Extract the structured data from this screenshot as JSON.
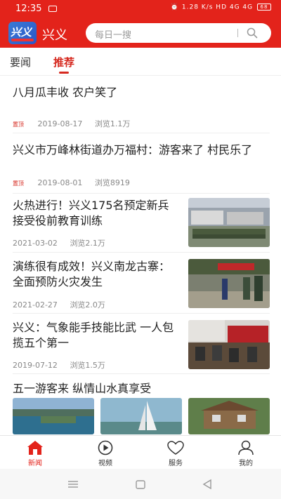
{
  "status_bar": {
    "time": "12:35",
    "network": "1.28 K/s",
    "signal": "HD 4G 4G",
    "battery": "68"
  },
  "header": {
    "logo_text": "兴义",
    "app_name": "兴义",
    "search_placeholder": "每日一搜"
  },
  "tabs": [
    {
      "label": "要闻"
    },
    {
      "label": "推荐"
    }
  ],
  "news": [
    {
      "title": "八月瓜丰收 农户笑了",
      "tag": "置顶",
      "date": "2019-08-17",
      "views": "浏览1.1万"
    },
    {
      "title": "兴义市万峰林街道办万福村：游客来了 村民乐了",
      "tag": "置顶",
      "date": "2019-08-01",
      "views": "浏览8919"
    },
    {
      "title": "火热进行！兴义175名预定新兵接受役前教育训练",
      "date": "2021-03-02",
      "views": "浏览2.1万"
    },
    {
      "title": "演练很有成效！兴义南龙古寨：全面预防火灾发生",
      "date": "2021-02-27",
      "views": "浏览2.0万"
    },
    {
      "title": "兴义：气象能手技能比武 一人包揽五个第一",
      "date": "2019-07-12",
      "views": "浏览1.5万"
    },
    {
      "title": "五一游客来 纵情山水真享受"
    }
  ],
  "bottom_nav": [
    {
      "label": "新闻"
    },
    {
      "label": "视频"
    },
    {
      "label": "服务"
    },
    {
      "label": "我的"
    }
  ],
  "colors": {
    "brand_red": "#e3231b",
    "tab_active": "#d62a20"
  }
}
